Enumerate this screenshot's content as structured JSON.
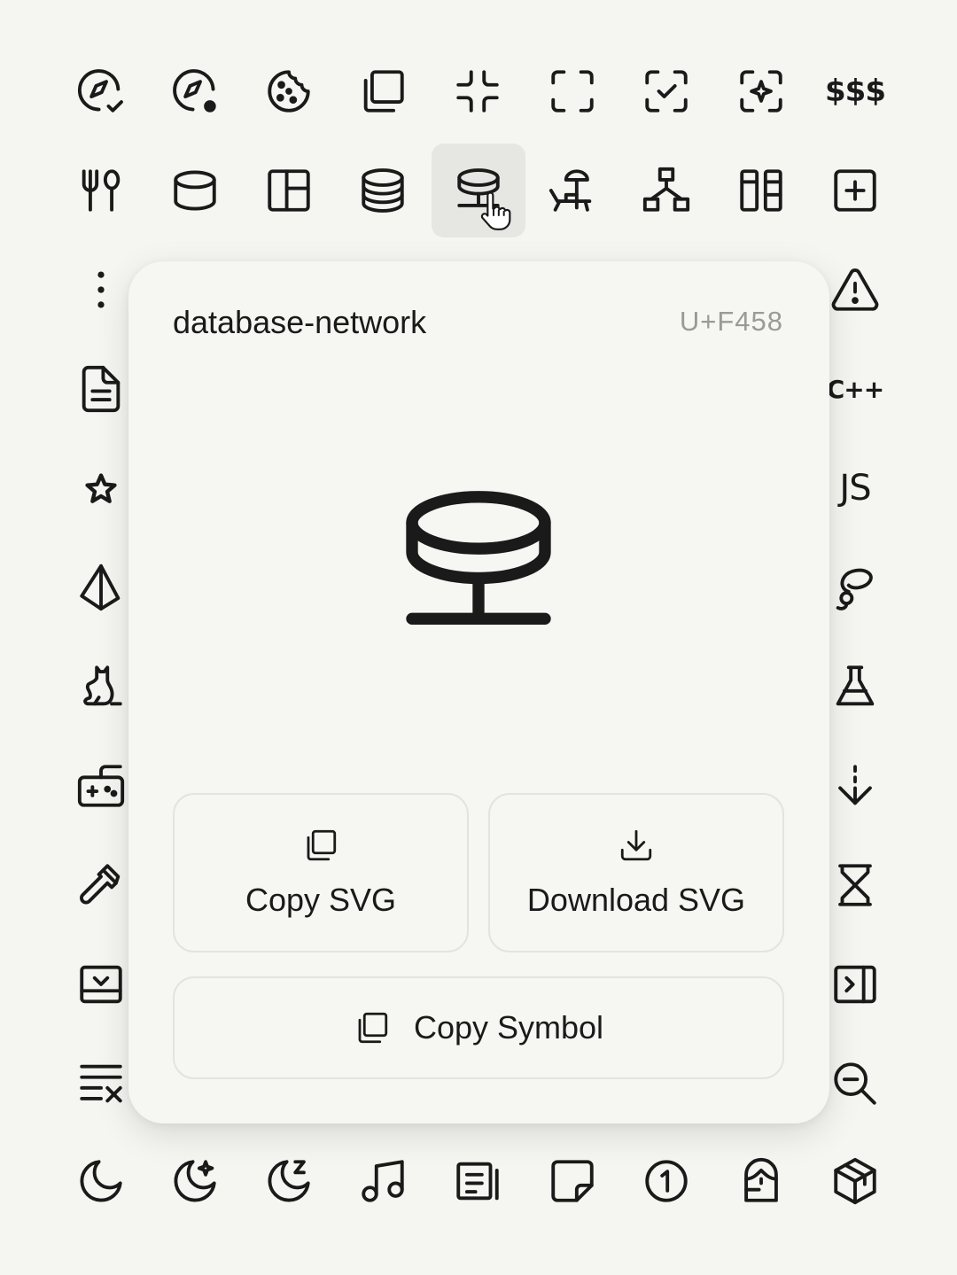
{
  "panel": {
    "icon_name": "database-network",
    "unicode": "U+F458",
    "copy_svg_label": "Copy SVG",
    "download_svg_label": "Download SVG",
    "copy_symbol_label": "Copy Symbol"
  },
  "text_icons": {
    "dollars": "$$$",
    "cpp": "C++",
    "js": "JS"
  },
  "grid_icons": [
    "compass-check-icon",
    "compass-dot-icon",
    "cookie-icon",
    "copy-icon",
    "collapse-icon",
    "expand-icon",
    "scan-check-icon",
    "scan-sparkle-icon",
    "currency-icon",
    "cutlery-icon",
    "database-icon",
    "layout-icon",
    "database-stack-icon",
    "database-network-icon",
    "beach-chair-icon",
    "hierarchy-icon",
    "columns-icon",
    "add-square-icon"
  ],
  "colors": {
    "background": "#f5f5f1",
    "panel": "#f6f6f2",
    "ink": "#1a1a1a",
    "muted": "#9a9a96",
    "hover": "#e6e6e2"
  }
}
